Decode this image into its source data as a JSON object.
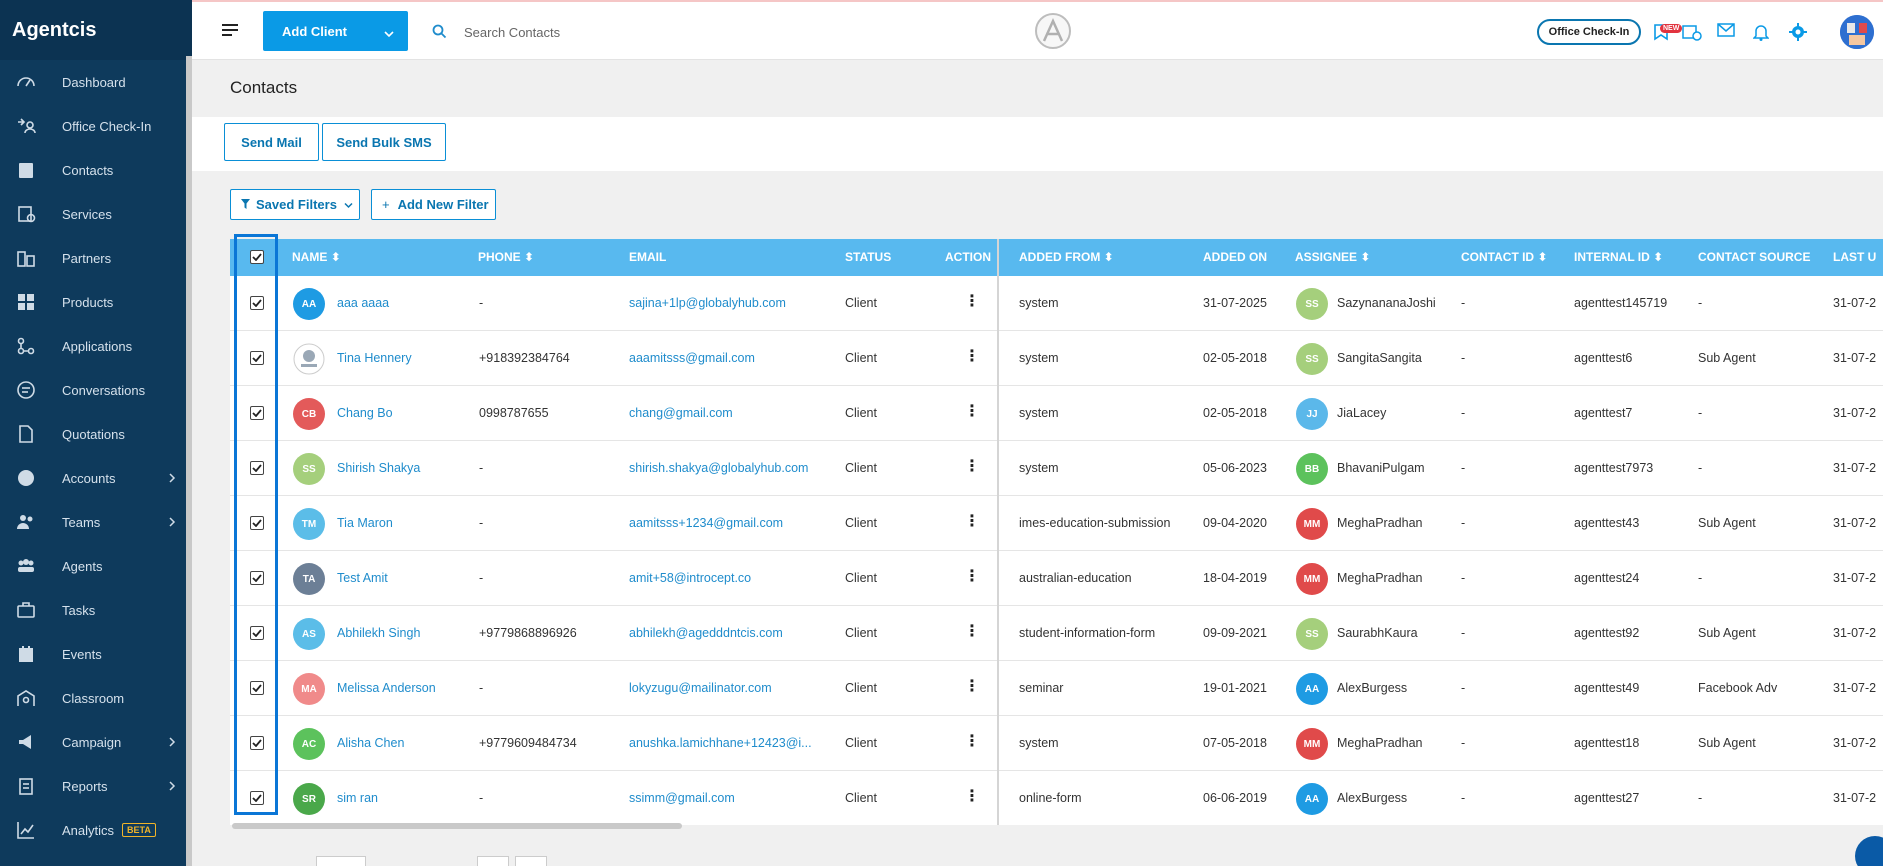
{
  "brand": "Agentcis",
  "sidebar": {
    "items": [
      {
        "label": "Dashboard",
        "icon": "dashboard-icon",
        "chevron": false
      },
      {
        "label": "Office Check-In",
        "icon": "checkin-icon",
        "chevron": false
      },
      {
        "label": "Contacts",
        "icon": "contacts-icon",
        "chevron": false
      },
      {
        "label": "Services",
        "icon": "services-icon",
        "chevron": false
      },
      {
        "label": "Partners",
        "icon": "partners-icon",
        "chevron": false
      },
      {
        "label": "Products",
        "icon": "products-icon",
        "chevron": false
      },
      {
        "label": "Applications",
        "icon": "applications-icon",
        "chevron": false
      },
      {
        "label": "Conversations",
        "icon": "conversations-icon",
        "chevron": false
      },
      {
        "label": "Quotations",
        "icon": "quotations-icon",
        "chevron": false
      },
      {
        "label": "Accounts",
        "icon": "accounts-icon",
        "chevron": true
      },
      {
        "label": "Teams",
        "icon": "teams-icon",
        "chevron": true
      },
      {
        "label": "Agents",
        "icon": "agents-icon",
        "chevron": false
      },
      {
        "label": "Tasks",
        "icon": "tasks-icon",
        "chevron": false
      },
      {
        "label": "Events",
        "icon": "events-icon",
        "chevron": false
      },
      {
        "label": "Classroom",
        "icon": "classroom-icon",
        "chevron": false
      },
      {
        "label": "Campaign",
        "icon": "campaign-icon",
        "chevron": true
      },
      {
        "label": "Reports",
        "icon": "reports-icon",
        "chevron": true
      },
      {
        "label": "Analytics",
        "icon": "analytics-icon",
        "chevron": false,
        "badge": "BETA"
      }
    ]
  },
  "topbar": {
    "add_client_label": "Add Client",
    "search_placeholder": "Search Contacts",
    "office_checkin_label": "Office Check-In",
    "new_badge": "NEW"
  },
  "page": {
    "title": "Contacts",
    "send_mail_label": "Send Mail",
    "send_bulk_sms_label": "Send Bulk SMS",
    "saved_filters_label": "Saved Filters",
    "add_new_filter_label": "Add New Filter"
  },
  "table": {
    "headers": {
      "name": "NAME",
      "phone": "PHONE",
      "email": "EMAIL",
      "status": "STATUS",
      "action": "ACTION",
      "added_from": "ADDED FROM",
      "added_on": "ADDED ON",
      "assignee": "ASSIGNEE",
      "contact_id": "CONTACT ID",
      "internal_id": "INTERNAL ID",
      "contact_source": "CONTACT SOURCE",
      "last_updated": "LAST U"
    },
    "rows": [
      {
        "initials": "AA",
        "avatar_color": "#1e9be3",
        "name": "aaa aaaa",
        "phone": "-",
        "email": "sajina+1lp@globalyhub.com",
        "status": "Client",
        "added_from": "system",
        "added_on": "31-07-2025",
        "assignee_initials": "SS",
        "assignee_color": "#a5cf7c",
        "assignee": "SazynananaJoshi",
        "contact_id": "-",
        "internal_id": "agenttest145719",
        "contact_source": "-",
        "last_updated": "31-07-2"
      },
      {
        "initials": "",
        "avatar_color": "#ffffff",
        "avatar_image": true,
        "name": "Tina Hennery",
        "phone": "+918392384764",
        "email": "aaamitsss@gmail.com",
        "status": "Client",
        "added_from": "system",
        "added_on": "02-05-2018",
        "assignee_initials": "SS",
        "assignee_color": "#a5cf7c",
        "assignee": "SangitaSangita",
        "contact_id": "-",
        "internal_id": "agenttest6",
        "contact_source": "Sub Agent",
        "last_updated": "31-07-2"
      },
      {
        "initials": "CB",
        "avatar_color": "#e35a5a",
        "name": "Chang Bo",
        "phone": "0998787655",
        "email": "chang@gmail.com",
        "status": "Client",
        "added_from": "system",
        "added_on": "02-05-2018",
        "assignee_initials": "JJ",
        "assignee_color": "#5bb8ea",
        "assignee": "JiaLacey",
        "contact_id": "-",
        "internal_id": "agenttest7",
        "contact_source": "-",
        "last_updated": "31-07-2"
      },
      {
        "initials": "SS",
        "avatar_color": "#a5cf7c",
        "name": "Shirish Shakya",
        "phone": "-",
        "email": "shirish.shakya@globalyhub.com",
        "status": "Client",
        "added_from": "system",
        "added_on": "05-06-2023",
        "assignee_initials": "BB",
        "assignee_color": "#5cc25c",
        "assignee": "BhavaniPulgam",
        "contact_id": "-",
        "internal_id": "agenttest7973",
        "contact_source": "-",
        "last_updated": "31-07-2"
      },
      {
        "initials": "TM",
        "avatar_color": "#5bbde8",
        "name": "Tia Maron",
        "phone": "-",
        "email": "aamitsss+1234@gmail.com",
        "status": "Client",
        "added_from": "imes-education-submission",
        "added_on": "09-04-2020",
        "assignee_initials": "MM",
        "assignee_color": "#e04a4a",
        "assignee": "MeghaPradhan",
        "contact_id": "-",
        "internal_id": "agenttest43",
        "contact_source": "Sub Agent",
        "last_updated": "31-07-2"
      },
      {
        "initials": "TA",
        "avatar_color": "#6c7f96",
        "name": "Test Amit",
        "phone": "-",
        "email": "amit+58@introcept.co",
        "status": "Client",
        "added_from": "australian-education",
        "added_on": "18-04-2019",
        "assignee_initials": "MM",
        "assignee_color": "#e04a4a",
        "assignee": "MeghaPradhan",
        "contact_id": "-",
        "internal_id": "agenttest24",
        "contact_source": "-",
        "last_updated": "31-07-2"
      },
      {
        "initials": "AS",
        "avatar_color": "#5bbde8",
        "name": "Abhilekh Singh",
        "phone": "+9779868896926",
        "email": "abhilekh@agedddntcis.com",
        "status": "Client",
        "added_from": "student-information-form",
        "added_on": "09-09-2021",
        "assignee_initials": "SS",
        "assignee_color": "#a5cf7c",
        "assignee": "SaurabhKaura",
        "contact_id": "-",
        "internal_id": "agenttest92",
        "contact_source": "Sub Agent",
        "last_updated": "31-07-2"
      },
      {
        "initials": "MA",
        "avatar_color": "#f08a8a",
        "name": "Melissa Anderson",
        "phone": "-",
        "email": "lokyzugu@mailinator.com",
        "status": "Client",
        "added_from": "seminar",
        "added_on": "19-01-2021",
        "assignee_initials": "AA",
        "assignee_color": "#1e9be3",
        "assignee": "AlexBurgess",
        "contact_id": "-",
        "internal_id": "agenttest49",
        "contact_source": "Facebook Adv",
        "last_updated": "31-07-2"
      },
      {
        "initials": "AC",
        "avatar_color": "#5cc25c",
        "name": "Alisha Chen",
        "phone": "+9779609484734",
        "email": "anushka.lamichhane+12423@i...",
        "status": "Client",
        "added_from": "system",
        "added_on": "07-05-2018",
        "assignee_initials": "MM",
        "assignee_color": "#e04a4a",
        "assignee": "MeghaPradhan",
        "contact_id": "-",
        "internal_id": "agenttest18",
        "contact_source": "Sub Agent",
        "last_updated": "31-07-2"
      },
      {
        "initials": "SR",
        "avatar_color": "#4aa84a",
        "name": "sim ran",
        "phone": "-",
        "email": "ssimm@gmail.com",
        "status": "Client",
        "added_from": "online-form",
        "added_on": "06-06-2019",
        "assignee_initials": "AA",
        "assignee_color": "#1e9be3",
        "assignee": "AlexBurgess",
        "contact_id": "-",
        "internal_id": "agenttest27",
        "contact_source": "-",
        "last_updated": "31-07-2"
      }
    ]
  },
  "colors": {
    "sidebar_bg": "#0e3a5c",
    "accent": "#0a9ae6",
    "table_header": "#58b9ef",
    "link": "#1f8ccc"
  }
}
